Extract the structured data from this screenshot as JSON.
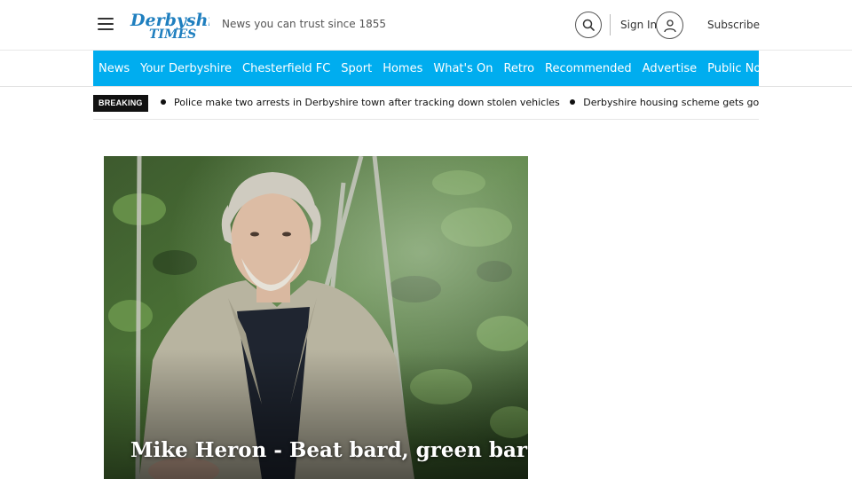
{
  "header": {
    "logo_top": "Derbyshire",
    "logo_bottom": "TIMES",
    "tagline": "News you can trust since 1855",
    "sign_in": "Sign In",
    "subscribe": "Subscribe",
    "icons": [
      "menu-icon",
      "search-icon",
      "user-icon"
    ]
  },
  "nav": {
    "items": [
      "News",
      "Your Derbyshire",
      "Chesterfield FC",
      "Sport",
      "Homes",
      "What's On",
      "Retro",
      "Recommended",
      "Advertise",
      "Public Notices"
    ],
    "background": "#00adef"
  },
  "breaking": {
    "label": "BREAKING",
    "headlines": [
      "Police make two arrests in Derbyshire town after tracking down stolen vehicles",
      "Derbyshire housing scheme gets go-ahead des"
    ]
  },
  "hero": {
    "title": "Mike Heron - Beat bard, green bard"
  }
}
